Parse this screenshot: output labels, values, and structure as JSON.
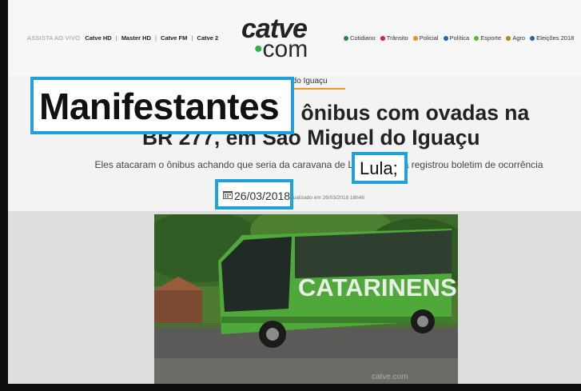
{
  "header": {
    "live_label": "ASSISTA AO VIVO",
    "channels": [
      "Catve HD",
      "Master HD",
      "Catve FM",
      "Catve 2"
    ],
    "separator": "|",
    "logo_top": "catve",
    "logo_bottom": "com",
    "logo_dot": "•",
    "categories": [
      {
        "label": "Cotidiano",
        "color": "#1f8a3a"
      },
      {
        "label": "Trânsito",
        "color": "#d62828"
      },
      {
        "label": "Policial",
        "color": "#f28c1a"
      },
      {
        "label": "Política",
        "color": "#2463b3"
      },
      {
        "label": "Esporte",
        "color": "#5cb82b"
      },
      {
        "label": "Agro",
        "color": "#b58a1a"
      },
      {
        "label": "Eleições 2018",
        "color": "#2463b3"
      }
    ]
  },
  "article": {
    "breadcrumb": "guel do Iguaçu",
    "headline_line1": "n ônibus com ovadas na",
    "headline_line2": "BR 277, em São Miguel do Iguaçu",
    "subhead": "Eles atacaram o ônibus achando que seria da caravana de Lula; empresa registrou boletim de ocorrência",
    "meta": "3 | Atualizado em 26/03/2018 16h46"
  },
  "highlights": {
    "manifestantes": "Manifestantes",
    "lula": "Lula;",
    "date": "26/03/2018"
  },
  "photo": {
    "bus_lettering": "CATARINENSE",
    "watermark": "catve.com"
  },
  "colors": {
    "highlight_border": "#1fa1dd",
    "accent_orange": "#f7941d",
    "bus_green": "#4fa83a"
  }
}
